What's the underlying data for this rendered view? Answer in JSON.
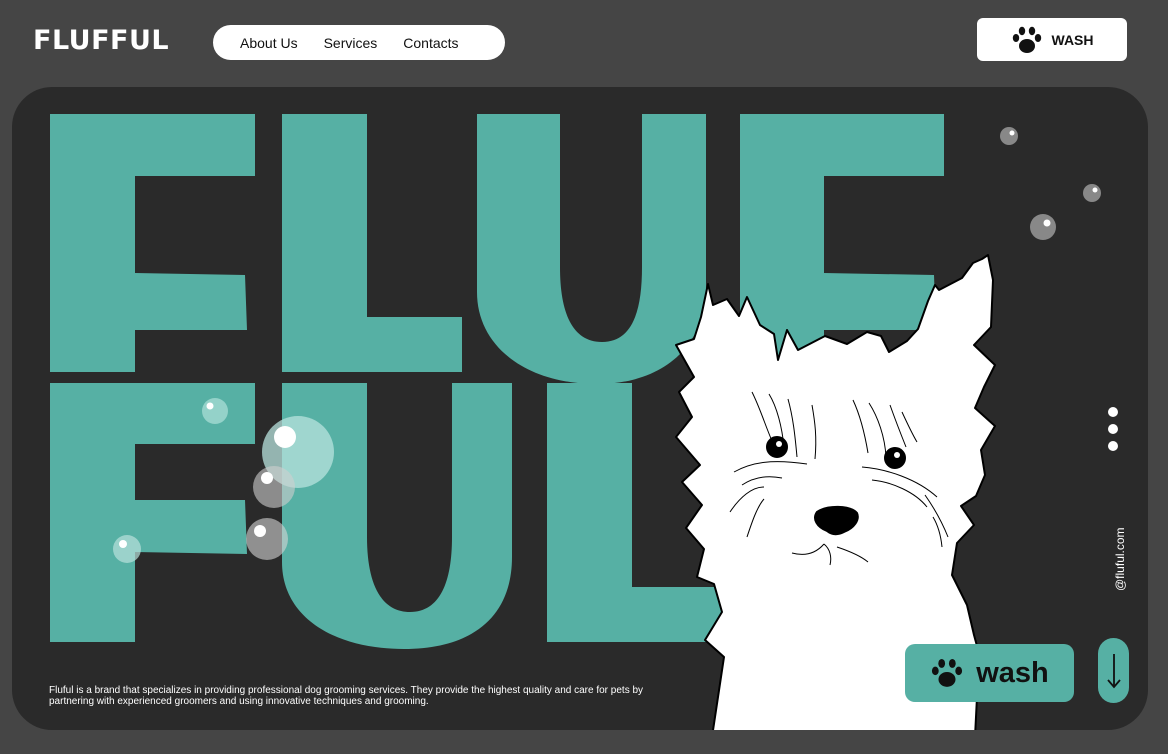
{
  "brand": {
    "logo": "FLUFFUL"
  },
  "nav": {
    "items": [
      "About Us",
      "Services",
      "Contacts"
    ]
  },
  "header": {
    "wash_label": "WASH"
  },
  "hero": {
    "big_words": [
      "FLUF",
      "FUL"
    ],
    "description": "Fluful is a brand that specializes in providing professional dog grooming services. They provide the highest quality and care for pets by partnering with experienced groomers and using innovative techniques and grooming.",
    "site": "@fluful.com",
    "wash_button": "wash",
    "illustration": "white-terrier-dog"
  },
  "colors": {
    "background": "#454545",
    "panel": "#2a2a2a",
    "accent": "#56b0a4",
    "text": "#ffffff"
  },
  "icons": [
    "paw-icon",
    "arrow-down-icon"
  ]
}
